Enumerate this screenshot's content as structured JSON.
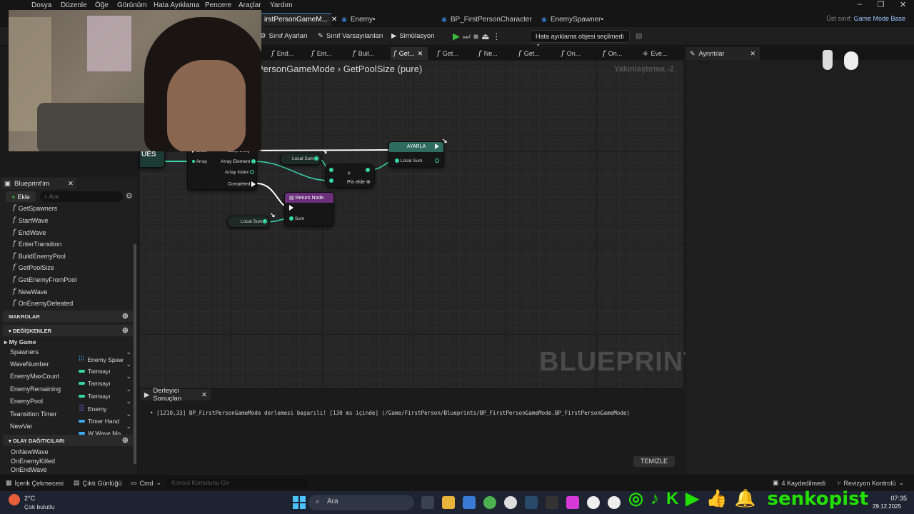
{
  "menu": [
    "Dosya",
    "Düzenle",
    "Öğe",
    "Görünüm",
    "Hata Ayıklama",
    "Pencere",
    "Araçlar",
    "Yardım"
  ],
  "doc_tabs": [
    "irstPersonGameM...",
    "Enemy•",
    "BP_FirstPersonCharacter",
    "EnemySpawner•"
  ],
  "parent_class": {
    "label": "Üst sınıf:",
    "value": "Game Mode Base"
  },
  "toolbar": {
    "class_settings": "Sınıf Ayarları",
    "class_defaults": "Sınıf Varsayılanları",
    "simulation": "Simülasyon",
    "debug_object": "Hata ayıklama objesi seçilmedi"
  },
  "graph_tabs": [
    "End...",
    "Ent...",
    "Buil...",
    "Get...",
    "Get...",
    "Ne...",
    "Get...",
    "On...",
    "On...",
    "Eve..."
  ],
  "details_tab": "Ayrıntılar",
  "graph": {
    "breadcrumb_a": "PersonGameMode",
    "breadcrumb_sep": "›",
    "breadcrumb_b": "GetPoolSize (pure)",
    "zoom": "Yakınlaştırma -2",
    "watermark": "BLUEPRINT",
    "left_node_fragment": "UES",
    "loop_pins": {
      "exec": "Exec",
      "array": "Array",
      "loop_body": "Loop Body",
      "array_element": "Array Element",
      "array_index": "Array Index",
      "completed": "Completed"
    },
    "local_sum_a": "Local Sum",
    "local_sum_b": "Local Sum",
    "set_node": {
      "title": "AYARLA",
      "pin": "Local Sum"
    },
    "add_pin": "Pin ekle",
    "return_node": {
      "title": "Return Node",
      "pin": "Sum"
    }
  },
  "my_blueprint": {
    "tab": "Blueprint'im",
    "add": "Ekle",
    "search_placeholder": "Ara",
    "functions": [
      "GetSpawners",
      "StartWave",
      "EndWave",
      "EnterTransition",
      "BuildEnemyPool",
      "GetPoolSize",
      "GetEnemyFromPool",
      "NewWave",
      "OnEnemyDefeated"
    ],
    "macros_header": "MAKROLAR",
    "variables_header": "DEĞİŞKENLER",
    "category": "My Game",
    "variables": [
      {
        "name": "Spawners",
        "type": "Enemy Spaw",
        "color": "#3fa9f5"
      },
      {
        "name": "WaveNumber",
        "type": "Tamsayı",
        "color": "#38d7a8"
      },
      {
        "name": "EnemyMaxCount",
        "type": "Tamsayı",
        "color": "#38d7a8"
      },
      {
        "name": "EnemyRemaining",
        "type": "Tamsayı",
        "color": "#38d7a8"
      },
      {
        "name": "EnemyPool",
        "type": "Enemy",
        "color": "#3fa9f5"
      },
      {
        "name": "Teansition Timer",
        "type": "Timer Hand",
        "color": "#3fa9f5"
      },
      {
        "name": "NewVar",
        "type": "W Wave Mo",
        "color": "#3fa9f5"
      }
    ],
    "dispatchers_header": "OLAY DAĞITICILARI",
    "dispatchers": [
      "OnNewWave",
      "OnEnemyKilled",
      "OnEndWave"
    ]
  },
  "compiler": {
    "tab": "Derleyici Sonuçları",
    "message": "[1210,33] BP_FirstPersonGameMode derlemesi başarılı! [130 ms içinde] (/Game/FirstPerson/Blueprints/BP_FirstPersonGameMode.BP_FirstPersonGameMode)",
    "clear": "TEMİZLE"
  },
  "statusbar": {
    "content_drawer": "İçerik Çekmecesi",
    "output_log": "Çıktı Günlüğü",
    "cmd": "Cmd",
    "console_placeholder": "Konsol Komutunu Gir",
    "saved": "4 Kaydedilmedi",
    "revision": "Revizyon Kontrolü"
  },
  "taskbar": {
    "temp": "2°C",
    "weather": "Çok bulutlu",
    "search": "Ara",
    "time": "07:35",
    "date": "29.12.2025"
  },
  "overlay": {
    "brand": "senkopist"
  }
}
